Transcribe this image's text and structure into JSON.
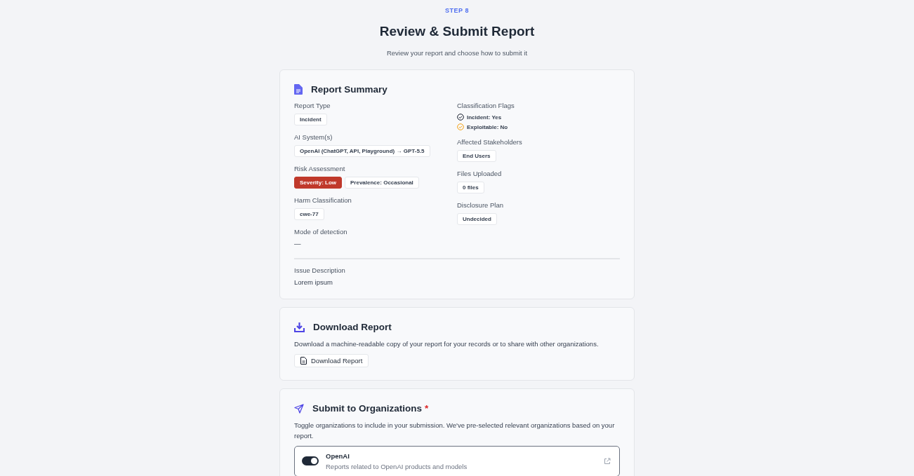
{
  "header": {
    "step": "STEP 8",
    "title": "Review & Submit Report",
    "subtitle": "Review your report and choose how to submit it"
  },
  "summary": {
    "title": "Report Summary",
    "left": [
      {
        "label": "Report Type",
        "kind": "badges",
        "badges": [
          {
            "text": "Incident",
            "kind": "plain"
          }
        ]
      },
      {
        "label": "AI System(s)",
        "kind": "badges",
        "badges": [
          {
            "text": "OpenAI (ChatGPT, API, Playground) → GPT-5.5",
            "kind": "plain"
          }
        ]
      },
      {
        "label": "Risk Assessment",
        "kind": "badges",
        "badges": [
          {
            "text": "Severity: Low",
            "kind": "danger"
          },
          {
            "text": "Prevalence: Occasional",
            "kind": "plain"
          }
        ]
      },
      {
        "label": "Harm Classification",
        "kind": "badges",
        "badges": [
          {
            "text": "cwe-77",
            "kind": "plain"
          }
        ]
      },
      {
        "label": "Mode of detection",
        "kind": "text",
        "text": "—"
      }
    ],
    "right": [
      {
        "label": "Classification Flags",
        "kind": "flags",
        "flags": [
          {
            "text": "Incident: Yes",
            "positive": true
          },
          {
            "text": "Exploitable: No",
            "positive": false
          }
        ]
      },
      {
        "label": "Affected Stakeholders",
        "kind": "badges",
        "badges": [
          {
            "text": "End Users",
            "kind": "plain"
          }
        ]
      },
      {
        "label": "Files Uploaded",
        "kind": "badges",
        "badges": [
          {
            "text": "0 files",
            "kind": "plain"
          }
        ]
      },
      {
        "label": "Disclosure Plan",
        "kind": "badges",
        "badges": [
          {
            "text": "Undecided",
            "kind": "plain"
          }
        ]
      }
    ],
    "description_label": "Issue Description",
    "description": "Lorem ipsum"
  },
  "download": {
    "title": "Download Report",
    "text": "Download a machine-readable copy of your report for your records or to share with other organizations.",
    "button": "Download Report"
  },
  "submit": {
    "title": "Submit to Organizations",
    "required": true,
    "required_mark": "*",
    "text": "Toggle organizations to include in your submission. We've pre-selected relevant organizations based on your report.",
    "organizations": [
      {
        "name": "OpenAI",
        "description": "Reports related to OpenAI products and models",
        "on": true
      }
    ]
  }
}
